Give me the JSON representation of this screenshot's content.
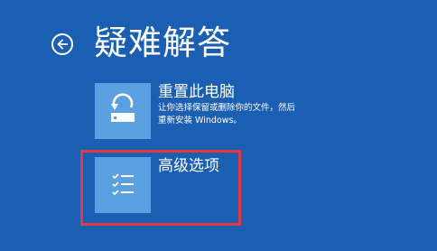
{
  "header": {
    "title": "疑难解答"
  },
  "options": [
    {
      "title": "重置此电脑",
      "description": "让你选择保留或删除你的文件，然后重新安装 Windows。",
      "icon": "reset-pc-icon"
    },
    {
      "title": "高级选项",
      "description": "",
      "icon": "checklist-icon"
    }
  ],
  "colors": {
    "background": "#1b5fb3",
    "tile": "#5ba0e0",
    "highlight_border": "#e0393e"
  }
}
